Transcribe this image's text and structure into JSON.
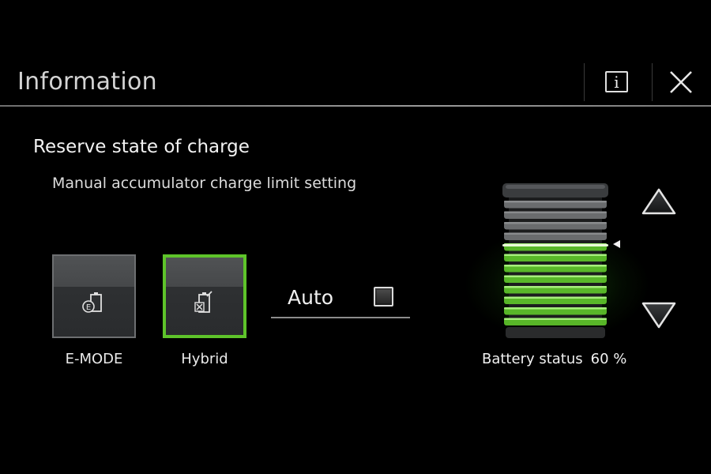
{
  "header": {
    "title": "Information"
  },
  "section": {
    "title": "Reserve state of charge",
    "subtitle": "Manual accumulator charge limit setting"
  },
  "modes": [
    {
      "label": "E-MODE",
      "icon": "e-mode-battery-icon",
      "selected": false
    },
    {
      "label": "Hybrid",
      "icon": "hybrid-battery-icon",
      "selected": true
    }
  ],
  "auto": {
    "label": "Auto",
    "checked": false
  },
  "battery": {
    "status_label": "Battery status",
    "status_value": "60 %",
    "charge_level": 0.6,
    "accent_color": "#5ec42a"
  },
  "icons": {
    "info": "info-icon",
    "close": "close-icon",
    "up": "arrow-up-icon",
    "down": "arrow-down-icon"
  }
}
